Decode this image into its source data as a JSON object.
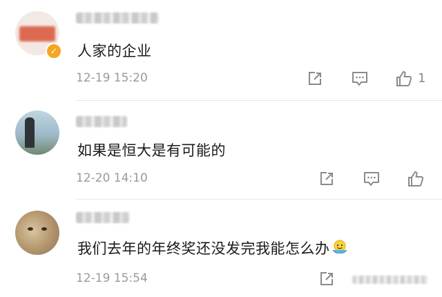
{
  "comments": [
    {
      "text": "人家的企业",
      "time": "12-19 15:20",
      "likes": "1",
      "verified": true
    },
    {
      "text": "如果是恒大是有可能的",
      "time": "12-20 14:10",
      "likes": ""
    },
    {
      "text": "我们去年的年终奖还没发完我能怎么办",
      "time": "12-19 15:54",
      "likes": ""
    }
  ],
  "icons": {
    "share": "share-icon",
    "comment": "comment-icon",
    "like": "thumbs-up-icon",
    "verified": "verified-badge-icon",
    "emoji": "shrug-emoji-icon"
  },
  "colors": {
    "verified_badge": "#f6a623",
    "meta_text": "#9a9a9a",
    "icon_gray": "#8a8a8a"
  }
}
